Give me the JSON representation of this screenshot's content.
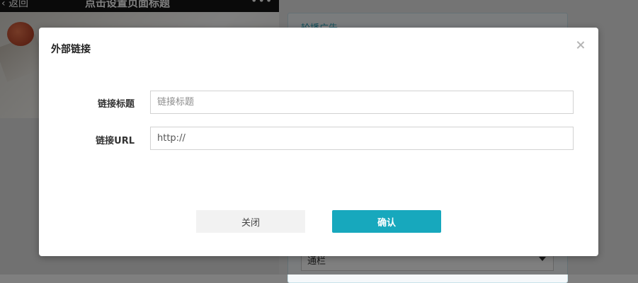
{
  "background": {
    "phone_header": {
      "back_label": "返回",
      "title": "点击设置页面标题",
      "more_label": "•••"
    },
    "right_panel": {
      "title": "轮播广告",
      "select_value": "通栏"
    }
  },
  "modal": {
    "title": "外部链接",
    "fields": [
      {
        "label": "链接标题",
        "placeholder": "链接标题",
        "value": ""
      },
      {
        "label": "链接URL",
        "placeholder": "",
        "value": "http://"
      }
    ],
    "buttons": {
      "close_label": "关闭",
      "confirm_label": "确认"
    }
  },
  "colors": {
    "accent": "#17a8bd",
    "overlay": "#7f7f7f"
  }
}
